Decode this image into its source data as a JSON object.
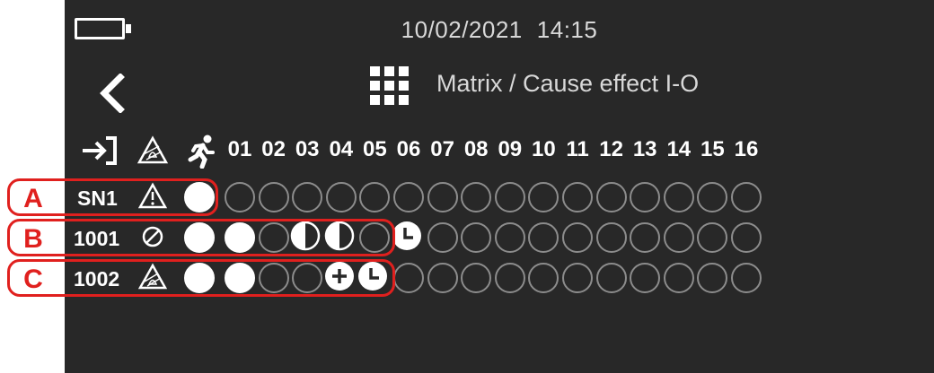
{
  "status_bar": {
    "battery_icon": "battery-empty-icon",
    "date": "10/02/2021",
    "time": "14:15"
  },
  "header": {
    "back_icon": "chevron-left-icon",
    "menu_icon": "grid-matrix-icon",
    "title": "Matrix / Cause effect I-O"
  },
  "matrix": {
    "header_icons": [
      "input-arrow-icon",
      "fire-alarm-triangle-icon",
      "evacuation-running-icon"
    ],
    "columns": [
      "01",
      "02",
      "03",
      "04",
      "05",
      "06",
      "07",
      "08",
      "09",
      "10",
      "11",
      "12",
      "13",
      "14",
      "15",
      "16"
    ],
    "rows": [
      {
        "marker": "A",
        "label": "SN1",
        "type_icon": "warning-triangle-icon",
        "evac_state": "on",
        "cells": [
          "off",
          "off",
          "off",
          "off",
          "off",
          "off",
          "off",
          "off",
          "off",
          "off",
          "off",
          "off",
          "off",
          "off",
          "off",
          "off"
        ]
      },
      {
        "marker": "B",
        "label": "1001",
        "type_icon": "disabled-circle-icon",
        "evac_state": "on",
        "cells": [
          "on",
          "off",
          "half",
          "half",
          "off",
          "delay",
          "off",
          "off",
          "off",
          "off",
          "off",
          "off",
          "off",
          "off",
          "off",
          "off"
        ]
      },
      {
        "marker": "C",
        "label": "1002",
        "type_icon": "fire-alarm-triangle-icon",
        "evac_state": "on",
        "cells": [
          "on",
          "off",
          "off",
          "plus",
          "delay",
          "off",
          "off",
          "off",
          "off",
          "off",
          "off",
          "off",
          "off",
          "off",
          "off",
          "off"
        ]
      }
    ]
  },
  "colors": {
    "screen_bg": "#282828",
    "cell_off_border": "#8c8c8c",
    "cell_on": "#ffffff",
    "annotation": "#e0201e"
  }
}
